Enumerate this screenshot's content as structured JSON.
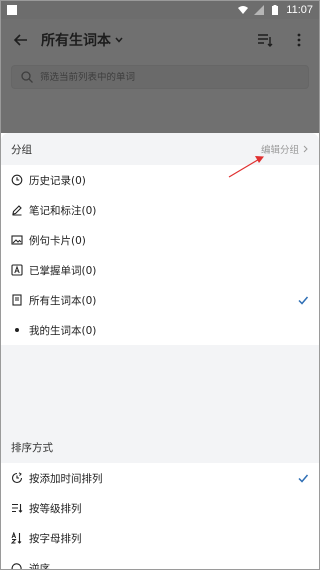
{
  "status_bar": {
    "time": "11:07"
  },
  "app_bar": {
    "title": "所有生词本"
  },
  "search": {
    "placeholder": "筛选当前列表中的单词"
  },
  "group_section": {
    "title": "分组",
    "edit_label": "编辑分组",
    "items": [
      {
        "label": "历史记录(0)",
        "icon": "clock-icon",
        "checked": false
      },
      {
        "label": "笔记和标注(0)",
        "icon": "pencil-icon",
        "checked": false
      },
      {
        "label": "例句卡片(0)",
        "icon": "image-card-icon",
        "checked": false
      },
      {
        "label": "已掌握单词(0)",
        "icon": "a-box-icon",
        "checked": false
      },
      {
        "label": "所有生词本(0)",
        "icon": "book-icon",
        "checked": true
      },
      {
        "label": "我的生词本(0)",
        "icon": "dot-icon",
        "checked": false
      }
    ]
  },
  "sort_section": {
    "title": "排序方式",
    "items": [
      {
        "label": "按添加时间排列",
        "icon": "time-sort-icon",
        "checked": true
      },
      {
        "label": "按等级排列",
        "icon": "level-sort-icon",
        "checked": false
      },
      {
        "label": "按字母排列",
        "icon": "alpha-sort-icon",
        "checked": false
      },
      {
        "label": "逆序",
        "icon": "reverse-icon",
        "checked": false
      }
    ]
  },
  "colors": {
    "accent": "#2f6fb5",
    "annotation_arrow": "#e03030"
  }
}
